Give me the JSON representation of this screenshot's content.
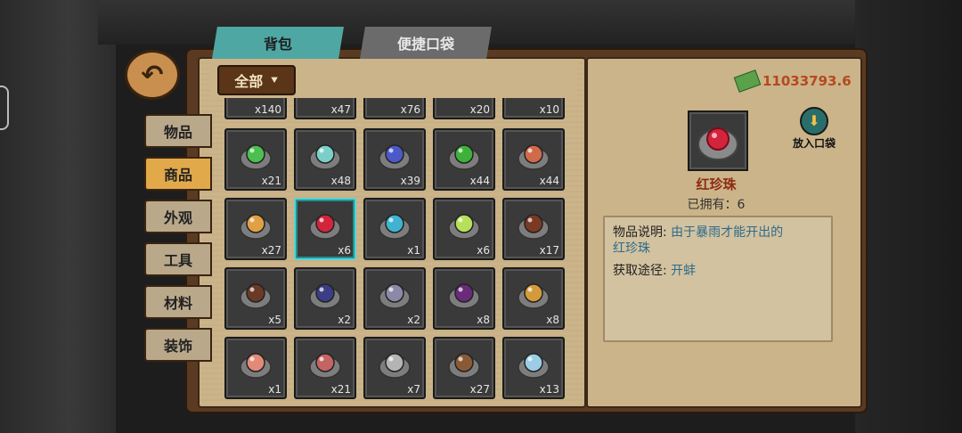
{
  "tabs": {
    "bag": "背包",
    "pocket": "便捷口袋"
  },
  "back_icon": "back-arrow-icon",
  "categories": [
    {
      "label": "物品",
      "active": false
    },
    {
      "label": "商品",
      "active": true
    },
    {
      "label": "外观",
      "active": false
    },
    {
      "label": "工具",
      "active": false
    },
    {
      "label": "材料",
      "active": false
    },
    {
      "label": "装饰",
      "active": false
    }
  ],
  "filter": {
    "label": "全部",
    "arrow": "double-chevron-down-icon"
  },
  "money": {
    "icon": "cash-stack-icon",
    "value": "11033793.6"
  },
  "grid": {
    "partial_row": [
      "x140",
      "x47",
      "x76",
      "x20",
      "x10"
    ],
    "rows": [
      [
        {
          "icon": "green-orb-stand-icon",
          "count": "x21",
          "color": "#4bc04f"
        },
        {
          "icon": "pearl-on-leaf-icon",
          "count": "x48",
          "color": "#7ad0c8"
        },
        {
          "icon": "blue-pearl-icon",
          "count": "x39",
          "color": "#4c59c9"
        },
        {
          "icon": "green-pearl-icon",
          "count": "x44",
          "color": "#3eb13a"
        },
        {
          "icon": "striped-pearl-icon",
          "count": "x44",
          "color": "#d06a4a"
        }
      ],
      [
        {
          "icon": "amber-pearl-icon",
          "count": "x27",
          "color": "#e0a043"
        },
        {
          "icon": "red-pearl-icon",
          "count": "x6",
          "color": "#d2253c",
          "selected": true
        },
        {
          "icon": "cyan-pearl-leaf-icon",
          "count": "x1",
          "color": "#3fb3d0"
        },
        {
          "icon": "lime-orb-stand-icon",
          "count": "x6",
          "color": "#b6e05a"
        },
        {
          "icon": "ring-box-icon",
          "count": "x17",
          "color": "#7a3a22"
        }
      ],
      [
        {
          "icon": "earring-box-icon",
          "count": "x5",
          "color": "#6b3a24"
        },
        {
          "icon": "pearl-necklace-pendant-icon",
          "count": "x2",
          "color": "#3b3d86"
        },
        {
          "icon": "pearl-necklace-box-icon",
          "count": "x2",
          "color": "#8a8aa8"
        },
        {
          "icon": "purple-ring-box-icon",
          "count": "x8",
          "color": "#6a2b7a"
        },
        {
          "icon": "gold-pendant-icon",
          "count": "x8",
          "color": "#d39a3a"
        }
      ],
      [
        {
          "icon": "jewelry-tray-icon",
          "count": "x1",
          "color": "#e18a78"
        },
        {
          "icon": "makeup-palette-icon",
          "count": "x21",
          "color": "#c46464"
        },
        {
          "icon": "thermos-icon",
          "count": "x7",
          "color": "#b4b4b4"
        },
        {
          "icon": "flip-flops-icon",
          "count": "x27",
          "color": "#8a5a36"
        },
        {
          "icon": "water-bottle-icon",
          "count": "x13",
          "color": "#9ccde6"
        }
      ]
    ]
  },
  "detail": {
    "icon": "red-pearl-icon",
    "pocket_button": {
      "icon": "download-tray-icon",
      "label": "放入口袋"
    },
    "name": "红珍珠",
    "owned_label": "已拥有：",
    "owned_count": "6",
    "desc_label": "物品说明:",
    "desc_text_1": "由于暴雨才能开出的",
    "desc_text_2": "红珍珠",
    "source_label": "获取途径:",
    "source_text": "开蚌"
  }
}
